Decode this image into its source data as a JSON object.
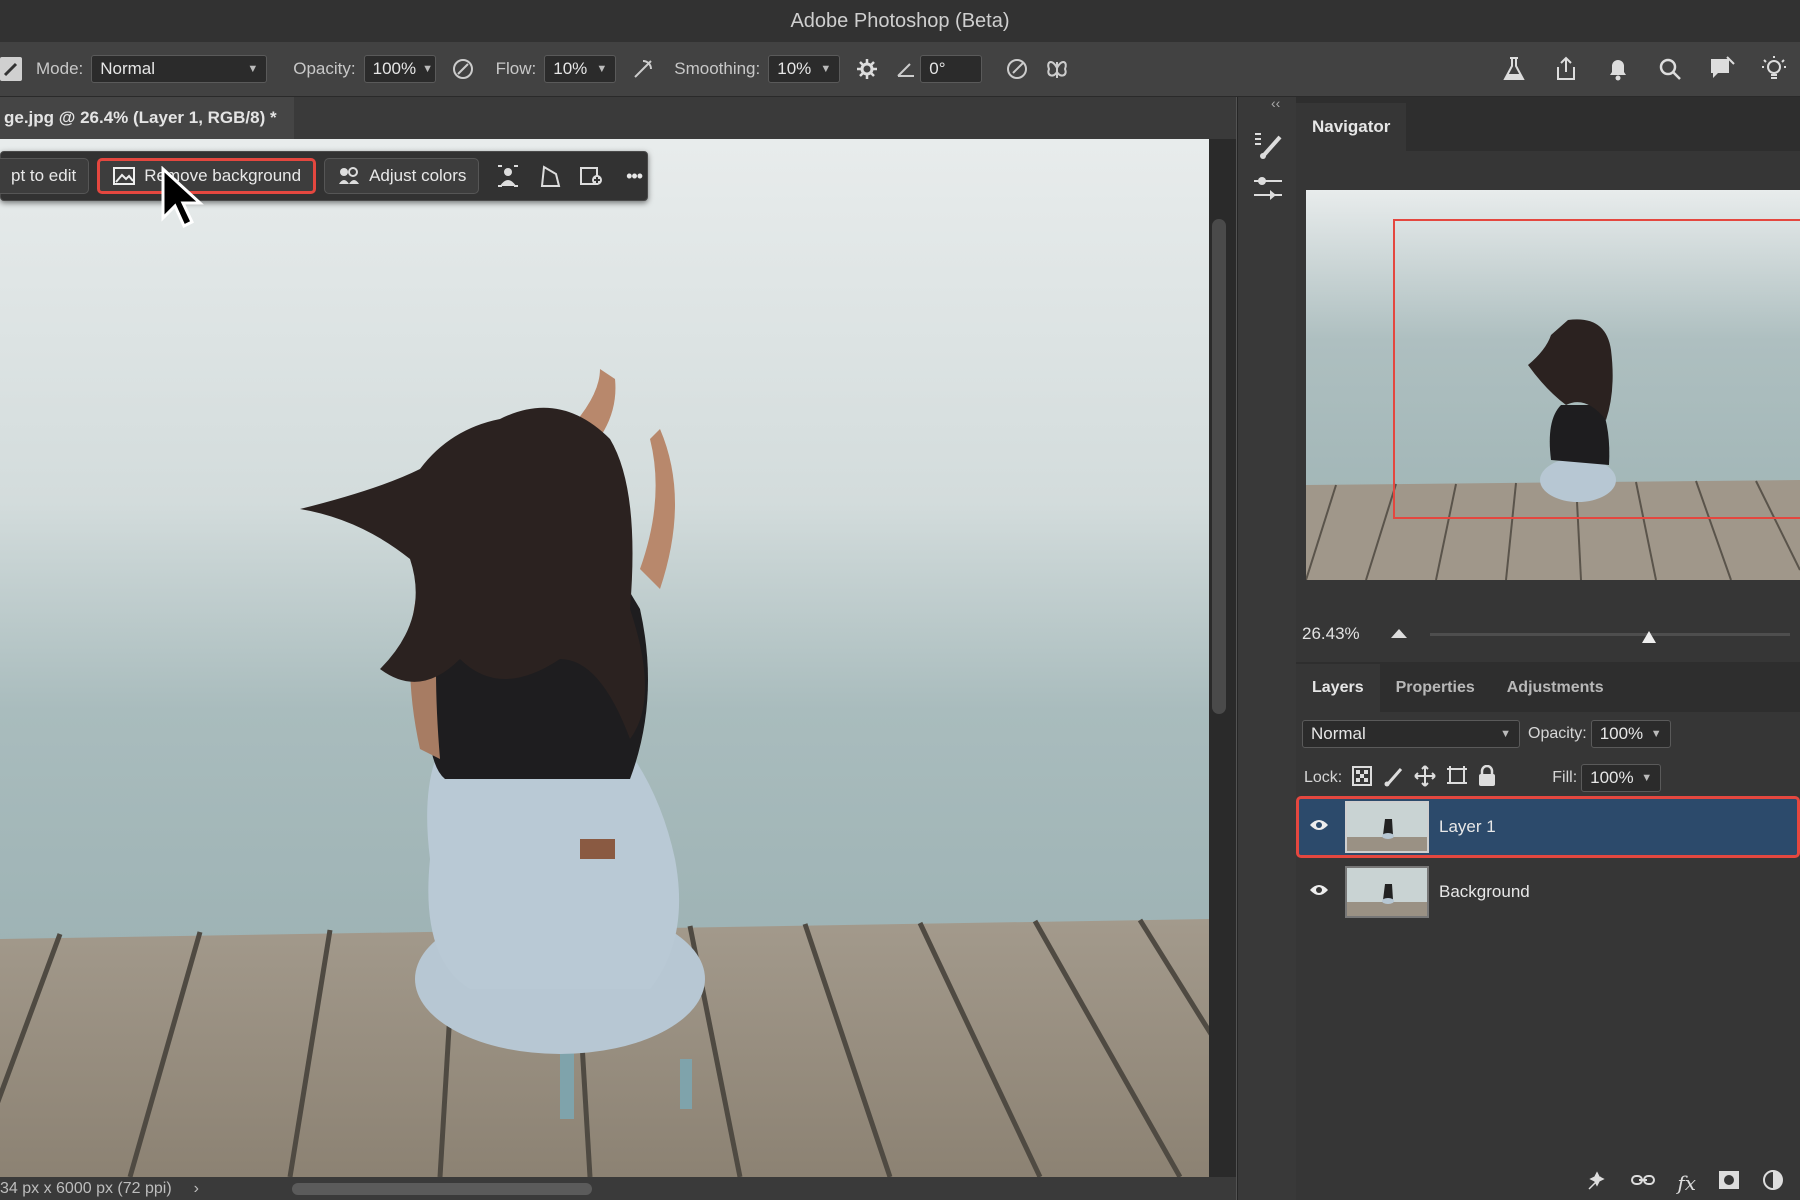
{
  "app": {
    "title": "Adobe Photoshop (Beta)"
  },
  "options_bar": {
    "mode_label": "Mode:",
    "mode_value": "Normal",
    "opacity_label": "Opacity:",
    "opacity_value": "100%",
    "flow_label": "Flow:",
    "flow_value": "10%",
    "smoothing_label": "Smoothing:",
    "smoothing_value": "10%",
    "angle_value": "0°"
  },
  "document": {
    "tab_title": "ge.jpg @ 26.4% (Layer 1, RGB/8) *",
    "status": "34 px x 6000 px (72 ppi)",
    "status_arrow": "›"
  },
  "context_bar": {
    "prompt_label": "pt to edit",
    "remove_bg_label": "Remove background",
    "adjust_colors_label": "Adjust colors",
    "more_label": "•••"
  },
  "navigator": {
    "tab": "Navigator",
    "zoom": "26.43%",
    "zoom_slider_fraction": 0.61
  },
  "layers_panel": {
    "tabs": [
      "Layers",
      "Properties",
      "Adjustments"
    ],
    "blend_mode": "Normal",
    "opacity_label": "Opacity:",
    "opacity_value": "100%",
    "lock_label": "Lock:",
    "fill_label": "Fill:",
    "fill_value": "100%",
    "layers": [
      {
        "name": "Layer 1",
        "selected": true
      },
      {
        "name": "Background",
        "selected": false
      }
    ]
  },
  "colors": {
    "highlight": "#e4473f",
    "selection": "#2c4a6b"
  }
}
